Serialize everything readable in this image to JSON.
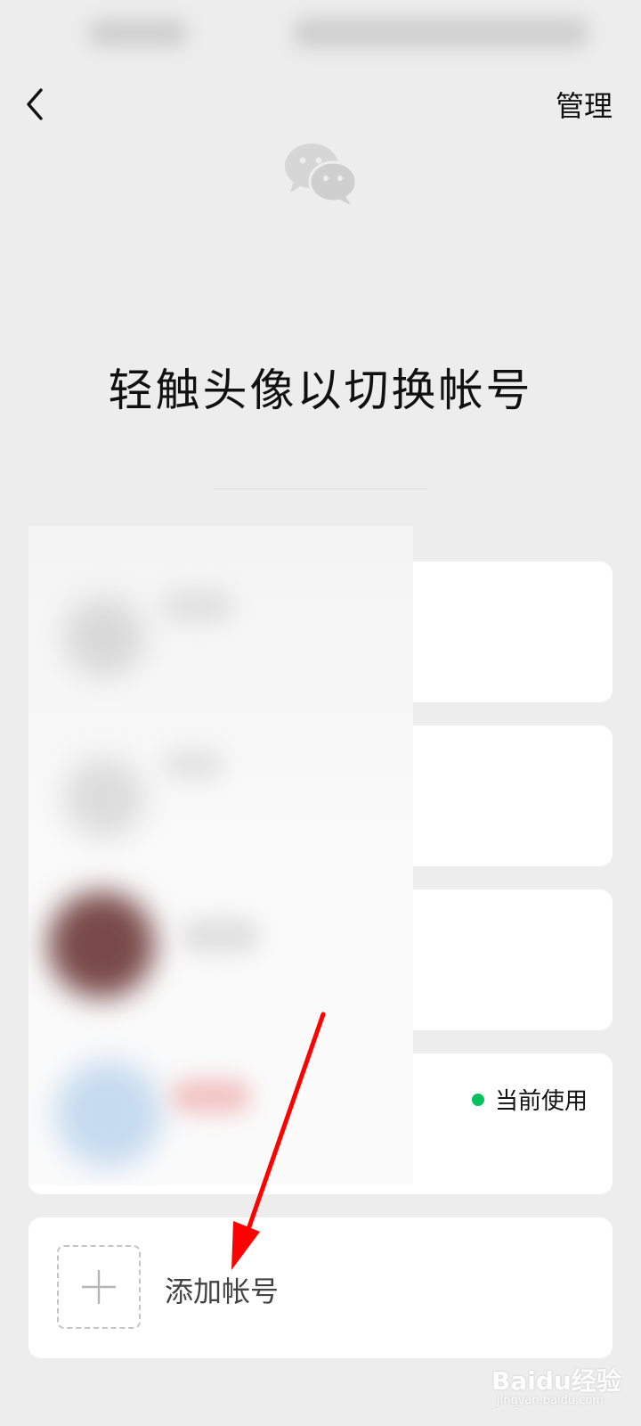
{
  "header": {
    "manage_label": "管理"
  },
  "main": {
    "title": "轻触头像以切换帐号"
  },
  "accounts": {
    "current_status": "当前使用"
  },
  "add_account": {
    "label": "添加帐号"
  },
  "watermark": {
    "brand": "Baidu经验",
    "sub": "jingyan.baidu.com"
  },
  "colors": {
    "background": "#ededed",
    "card": "#ffffff",
    "status_dot": "#07c160",
    "arrow": "#ff0000"
  },
  "icons": {
    "back": "chevron-left-icon",
    "logo": "wechat-logo-icon",
    "add": "plus-icon"
  }
}
